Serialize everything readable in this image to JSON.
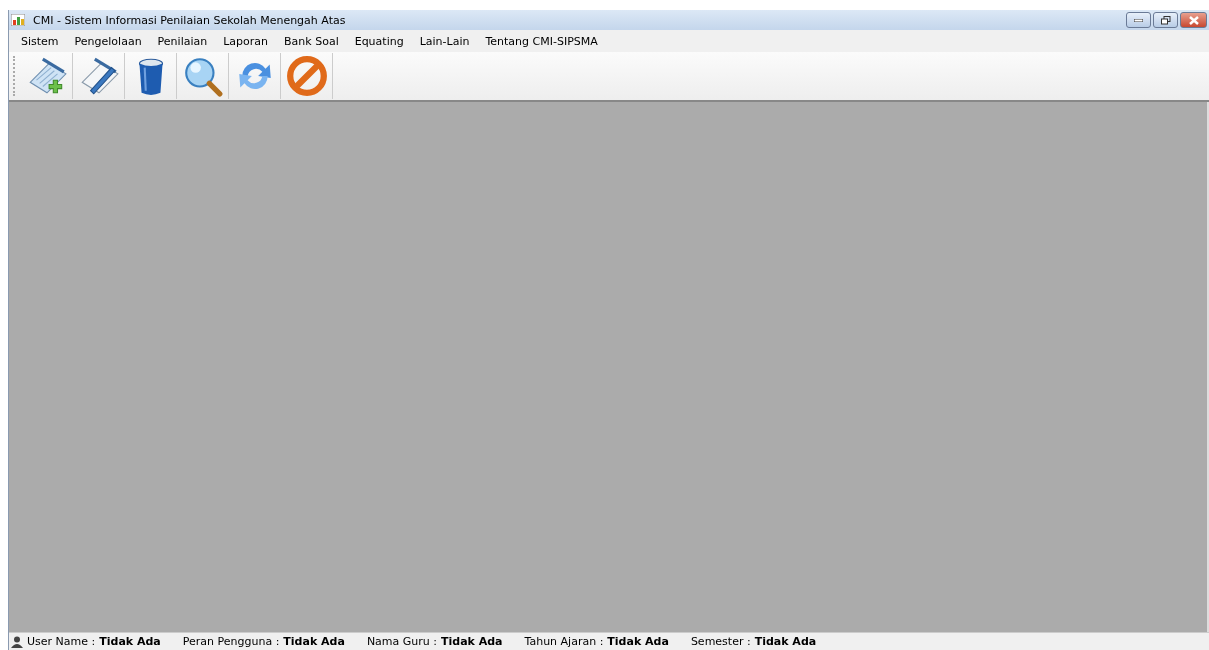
{
  "window": {
    "title": "CMI - Sistem Informasi Penilaian Sekolah Menengah Atas"
  },
  "menu": [
    "Sistem",
    "Pengelolaan",
    "Penilaian",
    "Laporan",
    "Bank Soal",
    "Equating",
    "Lain-Lain",
    "Tentang CMI-SIPSMA"
  ],
  "toolbar": [
    {
      "kind": "add"
    },
    {
      "kind": "edit"
    },
    {
      "kind": "delete"
    },
    {
      "kind": "search"
    },
    {
      "kind": "refresh"
    },
    {
      "kind": "cancel"
    }
  ],
  "status_bar": [
    {
      "label": "User Name :",
      "value": "Tidak Ada"
    },
    {
      "label": "Peran Pengguna :",
      "value": "Tidak Ada"
    },
    {
      "label": "Nama Guru :",
      "value": "Tidak Ada"
    },
    {
      "label": "Tahun Ajaran :",
      "value": "Tidak Ada"
    },
    {
      "label": "Semester :",
      "value": "Tidak Ada"
    }
  ]
}
